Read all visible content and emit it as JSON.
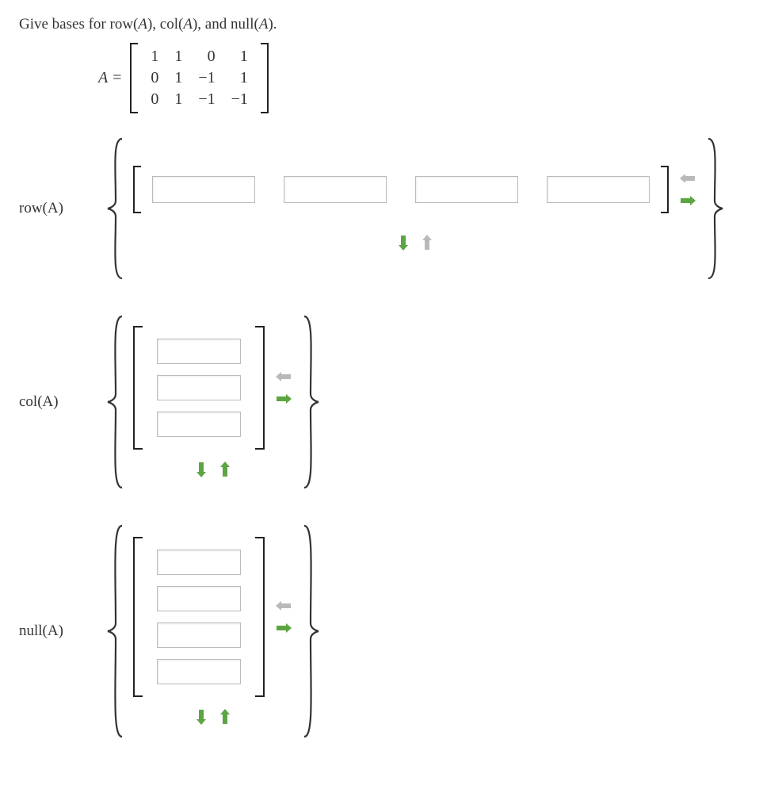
{
  "prompt_prefix": "Give bases for row(",
  "prompt_mid1": "), col(",
  "prompt_mid2": "), and null(",
  "prompt_suffix": ").",
  "matrix_var": "A",
  "equals": " = ",
  "matrix": {
    "rows": [
      [
        "1",
        "1",
        "0",
        "1"
      ],
      [
        "0",
        "1",
        "−1",
        "1"
      ],
      [
        "0",
        "1",
        "−1",
        "−1"
      ]
    ]
  },
  "labels": {
    "row": "row(A)",
    "col": "col(A)",
    "null": "null(A)"
  },
  "inputs": {
    "row_vec": [
      "",
      "",
      "",
      ""
    ],
    "col_vec": [
      "",
      "",
      ""
    ],
    "null_vec": [
      "",
      "",
      "",
      ""
    ]
  },
  "icons": {
    "arrow_left": "arrow-left",
    "arrow_right": "arrow-right",
    "arrow_up": "arrow-up",
    "arrow_down": "arrow-down"
  }
}
